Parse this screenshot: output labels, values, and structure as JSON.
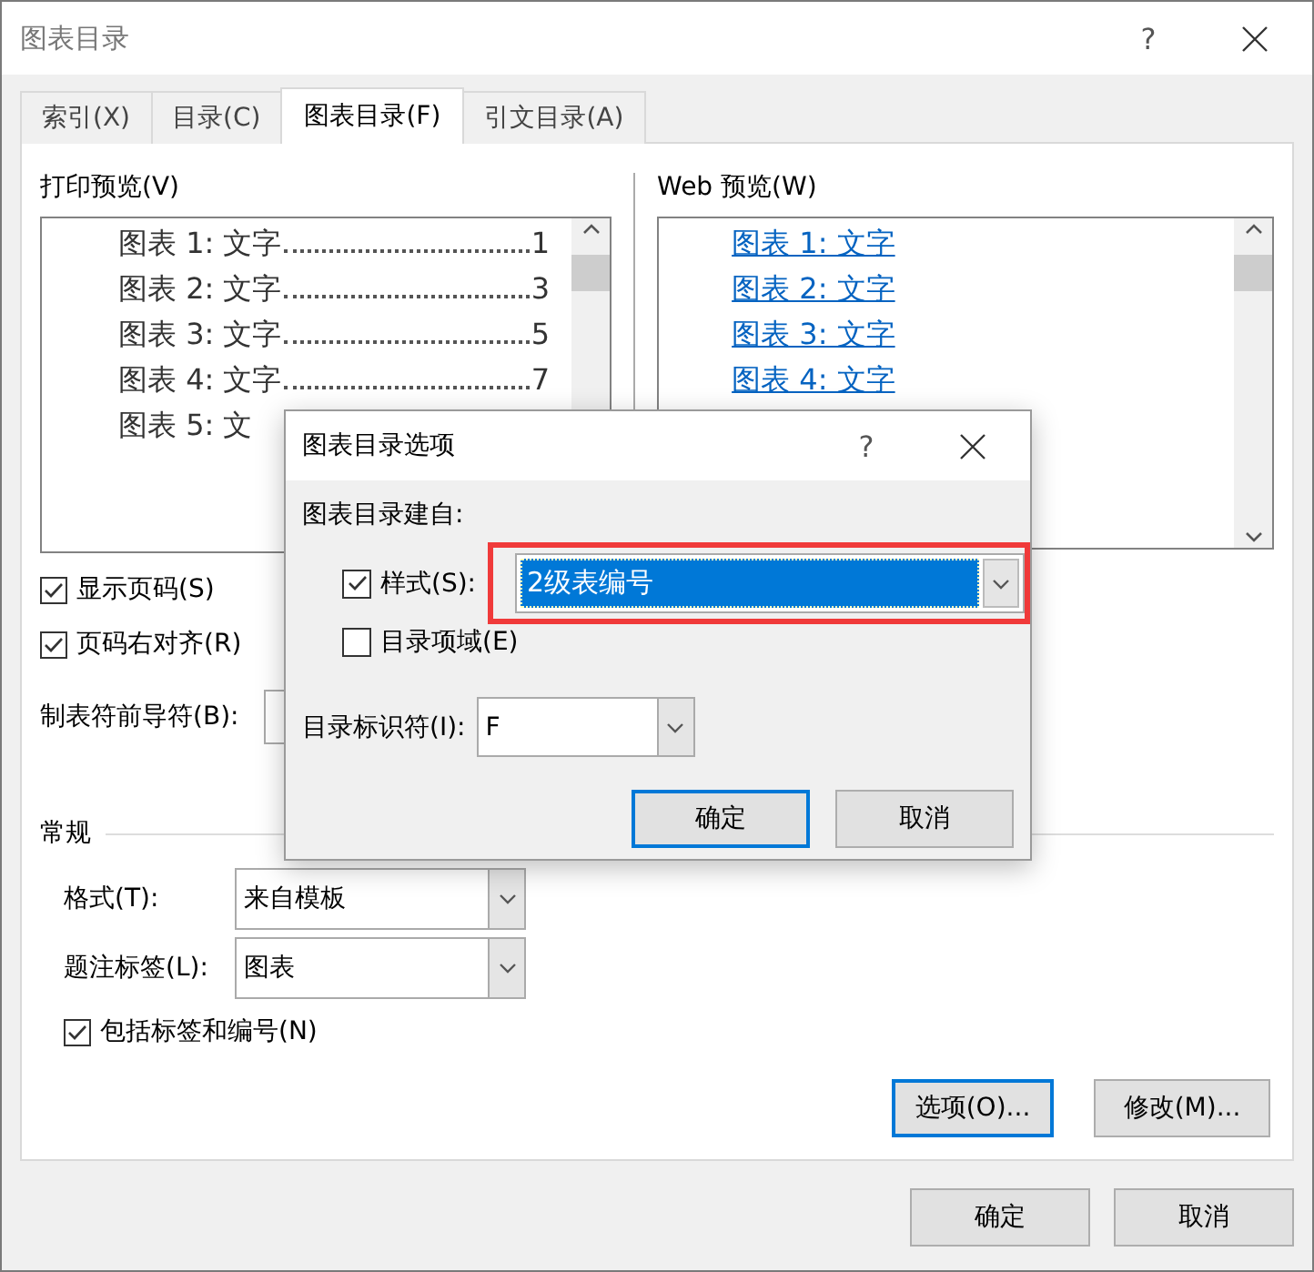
{
  "window": {
    "title": "图表目录",
    "help": "?"
  },
  "tabs": [
    {
      "label": "索引(X)",
      "selected": false
    },
    {
      "label": "目录(C)",
      "selected": false
    },
    {
      "label": "图表目录(F)",
      "selected": true
    },
    {
      "label": "引文目录(A)",
      "selected": false
    }
  ],
  "print_preview": {
    "label": "打印预览(V)",
    "entries": [
      {
        "text": "图表 1: 文字",
        "page": "1"
      },
      {
        "text": "图表 2: 文字",
        "page": "3"
      },
      {
        "text": "图表 3: 文字",
        "page": "5"
      },
      {
        "text": "图表 4: 文字",
        "page": "7"
      },
      {
        "text": "图表 5: 文"
      }
    ]
  },
  "web_preview": {
    "label": "Web 预览(W)",
    "entries": [
      "图表 1: 文字",
      "图表 2: 文字",
      "图表 3: 文字",
      "图表 4: 文字"
    ]
  },
  "options": [
    {
      "label": "显示页码(S)",
      "checked": true
    },
    {
      "label": "页码右对齐(R)",
      "checked": true
    }
  ],
  "tab_leader": {
    "label": "制表符前导符(B):"
  },
  "general": {
    "title": "常规",
    "format": {
      "label": "格式(T):",
      "value": "来自模板"
    },
    "caption_label": {
      "label": "题注标签(L):",
      "value": "图表"
    },
    "include": {
      "label": "包括标签和编号(N)",
      "checked": true
    }
  },
  "panel_buttons": [
    {
      "label": "选项(O)...",
      "focused": true
    },
    {
      "label": "修改(M)...",
      "focused": false
    }
  ],
  "buttons": [
    {
      "label": "确定",
      "focused": false
    },
    {
      "label": "取消",
      "focused": false
    }
  ],
  "options_dialog": {
    "title": "图表目录选项",
    "help": "?",
    "build_from": "图表目录建自:",
    "style": {
      "label": "样式(S):",
      "checked": true,
      "value": "2级表编号",
      "highlighted": true
    },
    "field": {
      "label": "目录项域(E)",
      "checked": false
    },
    "identifier": {
      "label": "目录标识符(I):",
      "value": "F"
    },
    "buttons": [
      {
        "label": "确定",
        "focused": true
      },
      {
        "label": "取消",
        "focused": false
      }
    ]
  }
}
